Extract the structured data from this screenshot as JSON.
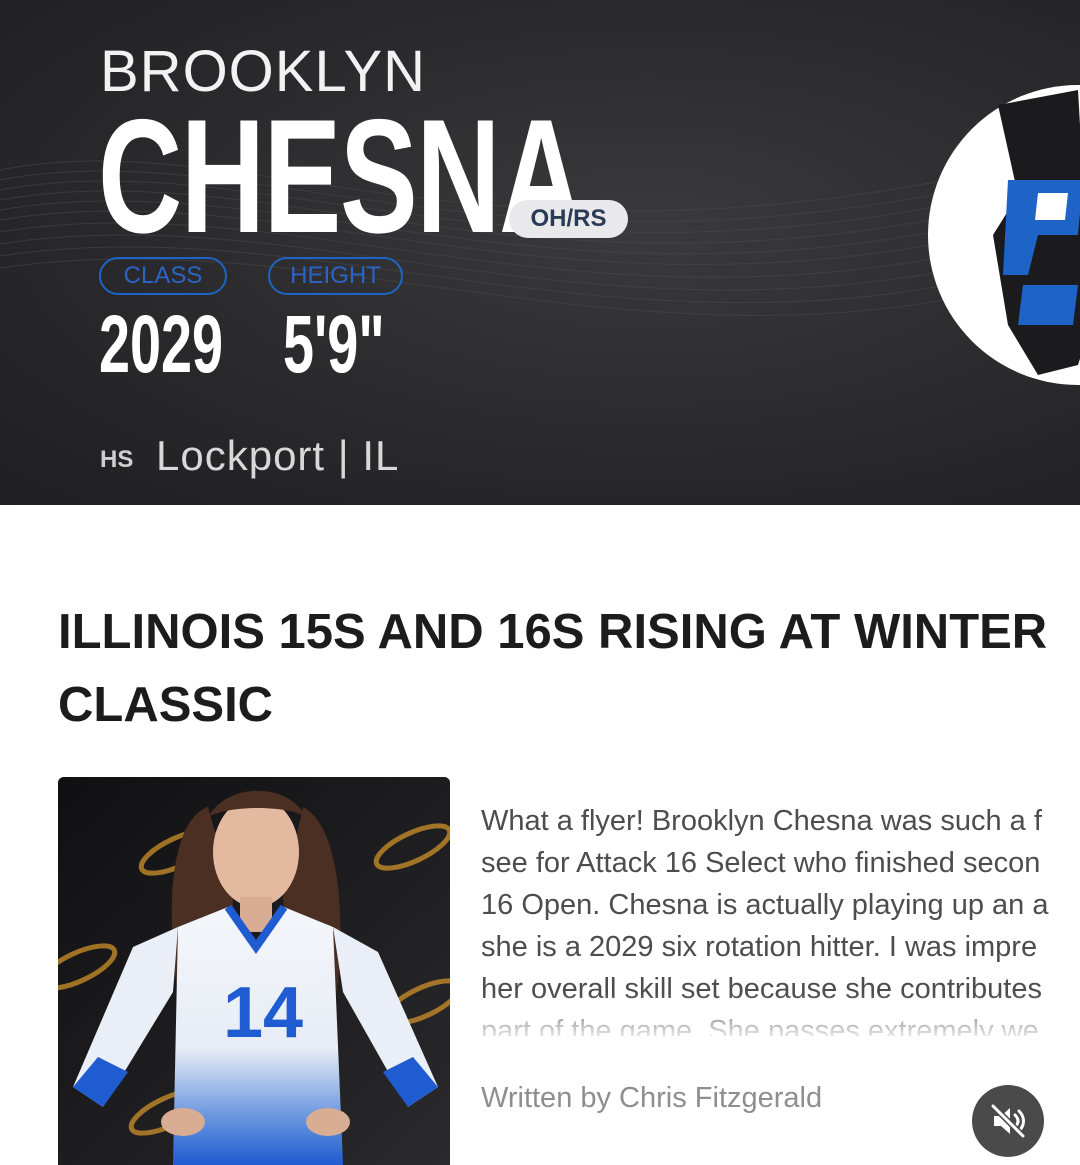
{
  "profile": {
    "first_name": "BROOKLYN",
    "last_name": "CHESNA",
    "position": "OH/RS",
    "class_label": "CLASS",
    "height_label": "HEIGHT",
    "class_year": "2029",
    "height": "5'9\"",
    "hs_label": "HS",
    "school": "Lockport | IL"
  },
  "article": {
    "headline": "ILLINOIS 15S AND 16S RISING AT WINTER CLASSIC",
    "lines": [
      "What a flyer!  Brooklyn Chesna was such a f",
      "see for Attack 16 Select who finished secon",
      "16 Open.  Chesna is actually playing up an a",
      "she is a 2029 six rotation hitter.  I was impre",
      "her overall skill set because she contributes",
      "part of the game.  She passes extremely we"
    ],
    "byline": "Written by Chris Fitzgerald",
    "photo_jersey_number": "14"
  },
  "colors": {
    "header_bg": "#2a2a2c",
    "accent_blue": "#1e63c6",
    "badge_bg": "#e9e9ec"
  },
  "icons": {
    "mute": "speaker-muted-icon"
  }
}
